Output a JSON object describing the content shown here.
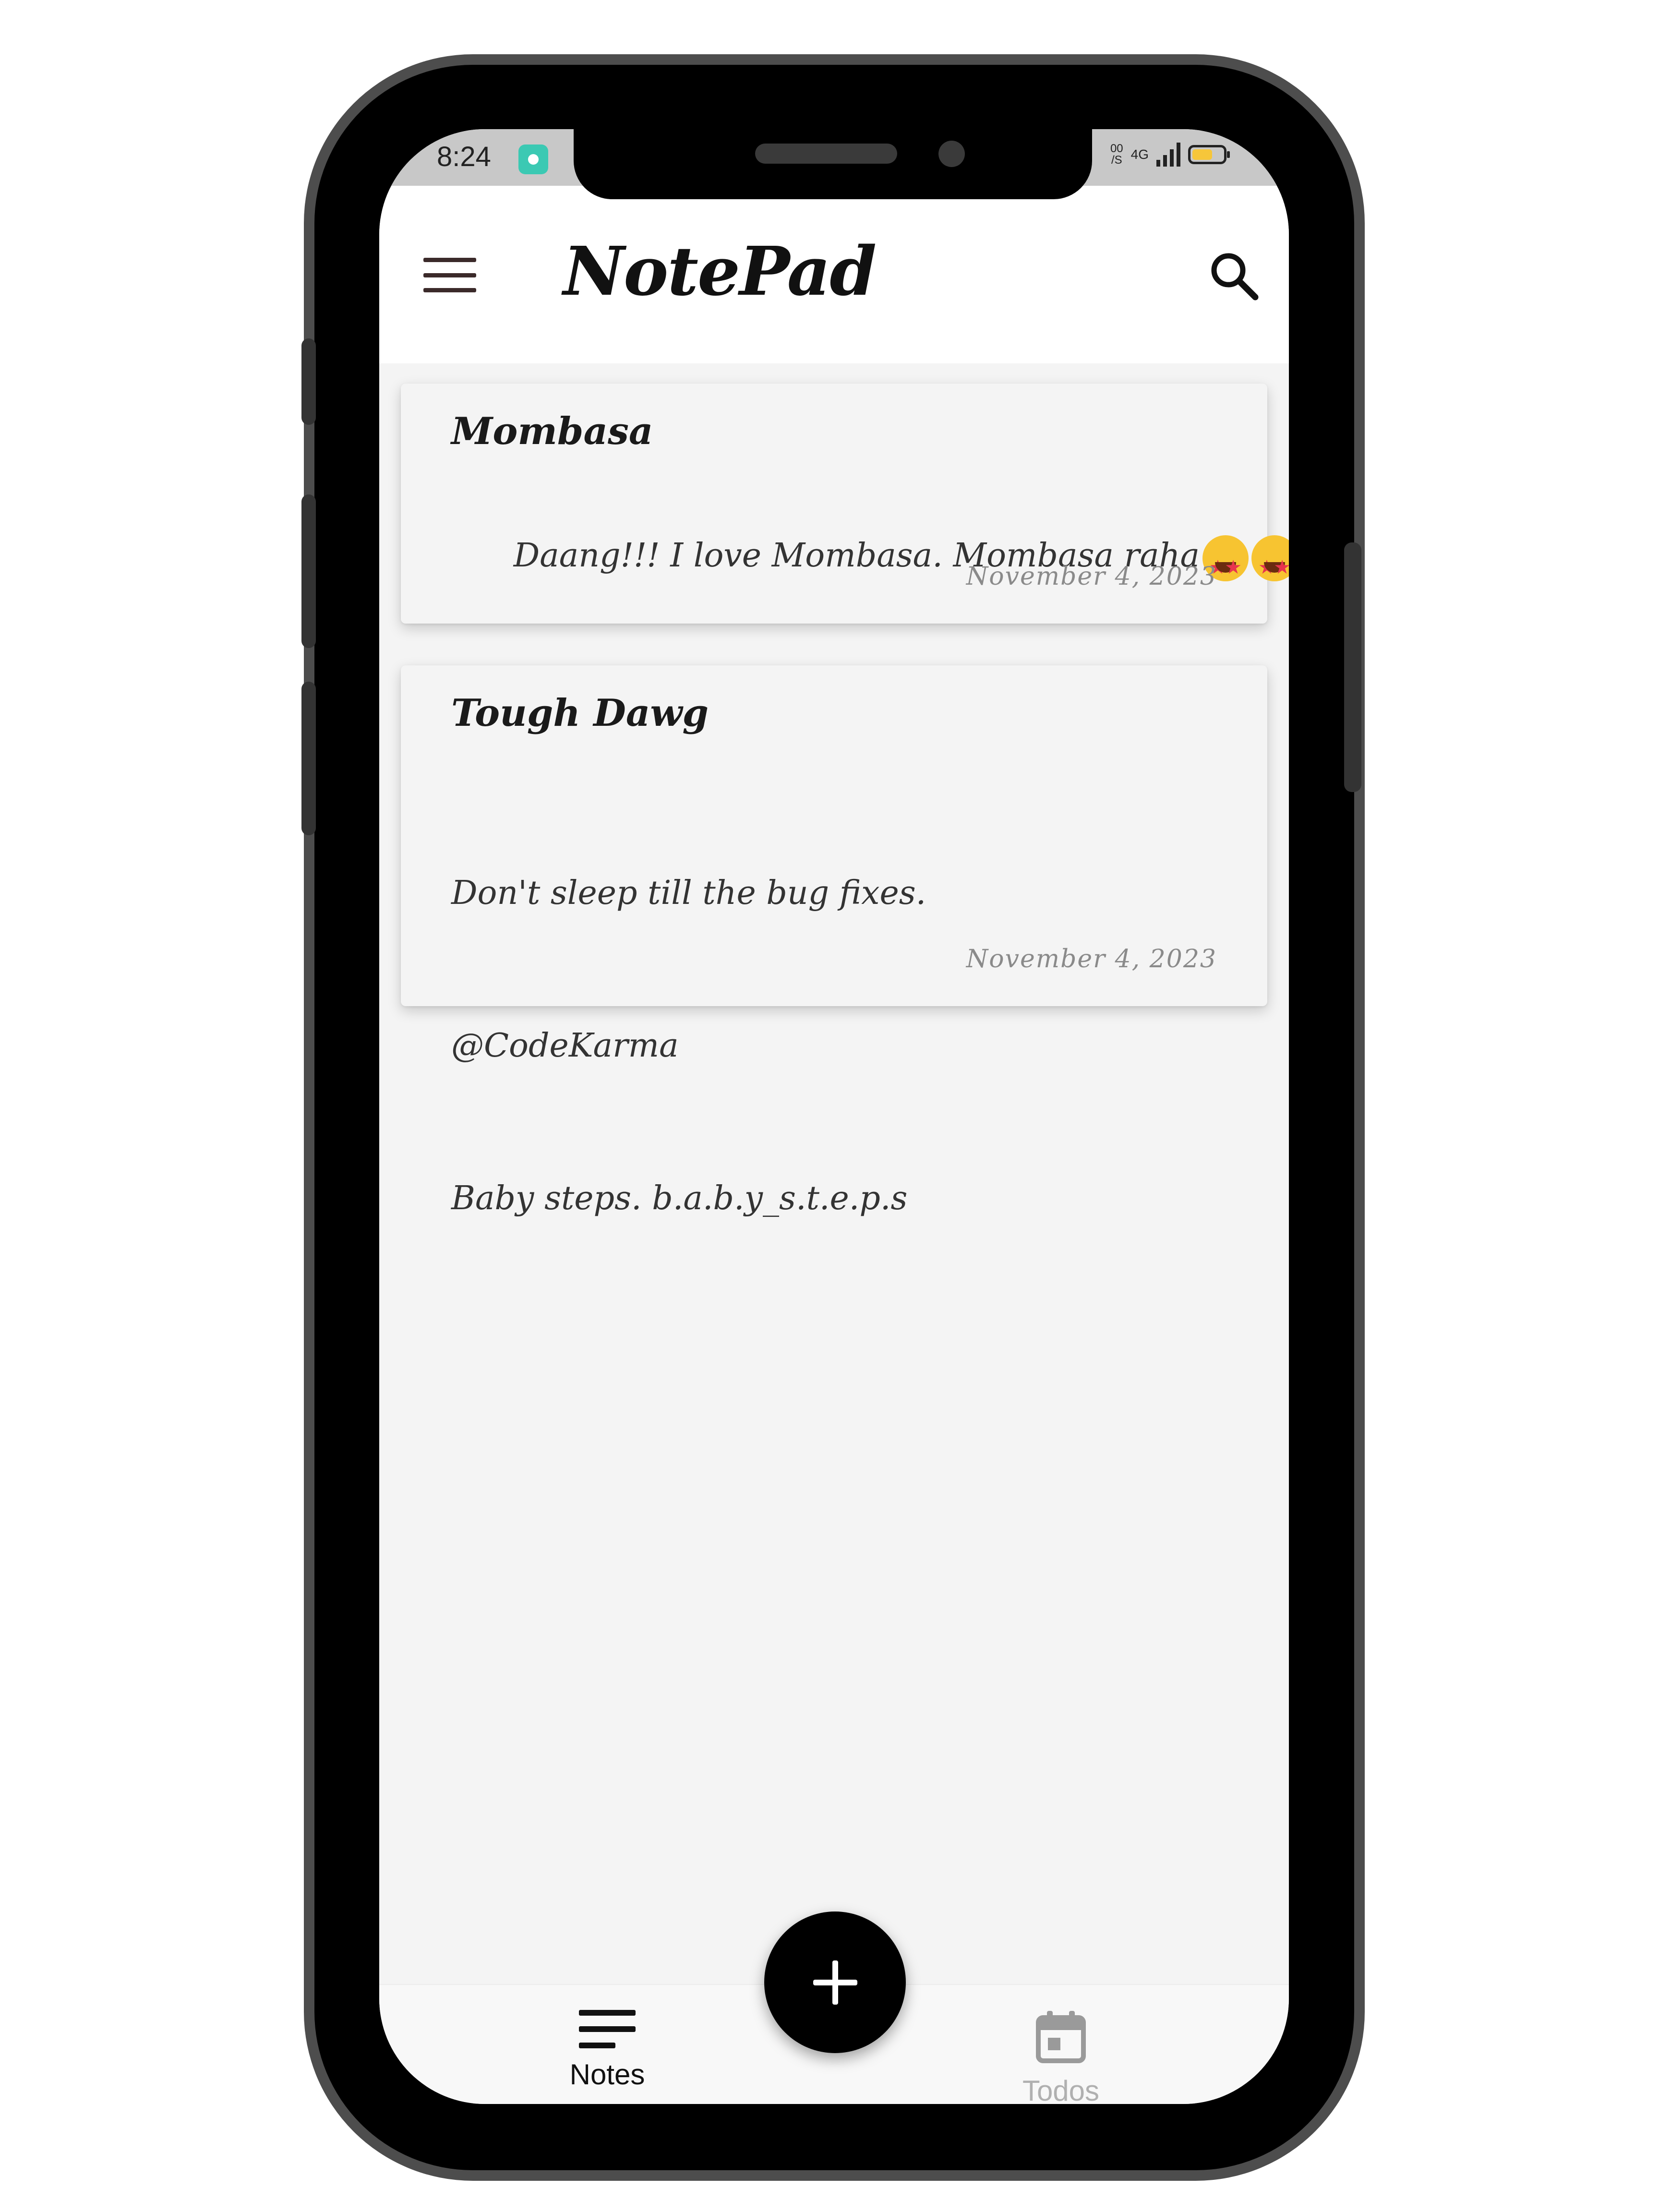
{
  "status_bar": {
    "time": "8:24",
    "net_speed_top": "00",
    "net_speed_bottom": "/S",
    "network": "4G"
  },
  "app_bar": {
    "title": "NotePad"
  },
  "notes": [
    {
      "title": "Mombasa",
      "body": "Daang!!! I love Mombasa. Mombasa raha",
      "emoji": "star-struck-emoji",
      "date": "November 4, 2023"
    },
    {
      "title": "Tough Dawg",
      "body_lines": [
        "Don't sleep till the bug fixes.",
        "@CodeKarma",
        "Baby steps. b.a.b.y_s.t.e.p.s"
      ],
      "date": "November 4, 2023"
    }
  ],
  "bottom_nav": {
    "notes_label": "Notes",
    "todos_label": "Todos"
  },
  "colors": {
    "accent": "#000000",
    "active_nav": "#111111",
    "inactive_nav": "#b0b0b0"
  }
}
